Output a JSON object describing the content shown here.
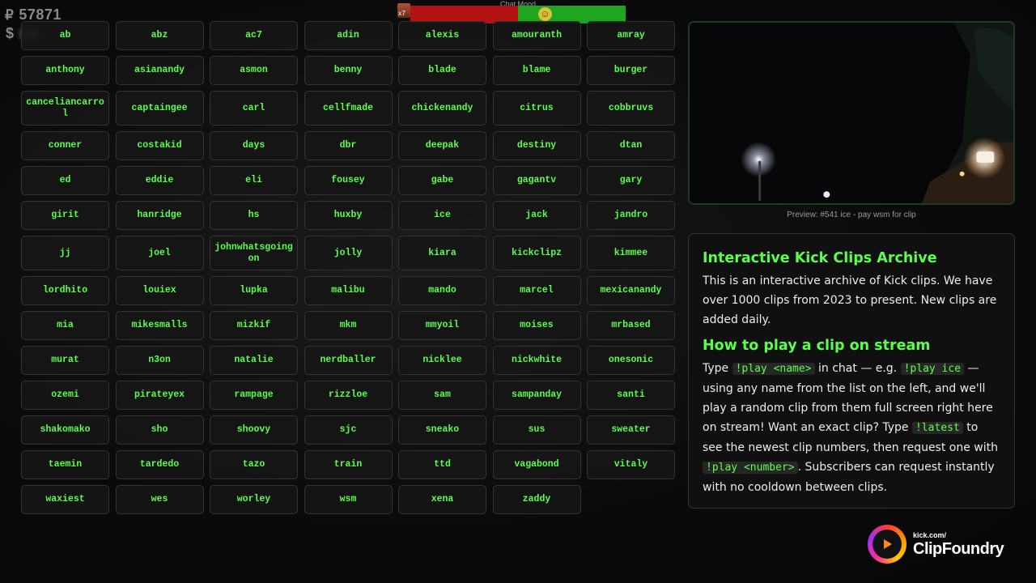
{
  "overlay": {
    "points_symbol": "₽",
    "points_value": "57871",
    "money_symbol": "$"
  },
  "chat_mood": {
    "title": "Chat Mood",
    "multiplier": "x7",
    "face": "☺",
    "neg_color": "#b31212",
    "pos_color": "#1fa51f"
  },
  "names": [
    "ab",
    "abz",
    "ac7",
    "adin",
    "alexis",
    "amouranth",
    "amray",
    "anthony",
    "asianandy",
    "asmon",
    "benny",
    "blade",
    "blame",
    "burger",
    "canceliancarrol",
    "captaingee",
    "carl",
    "cellfmade",
    "chickenandy",
    "citrus",
    "cobbruvs",
    "conner",
    "costakid",
    "days",
    "dbr",
    "deepak",
    "destiny",
    "dtan",
    "ed",
    "eddie",
    "eli",
    "fousey",
    "gabe",
    "gagantv",
    "gary",
    "girit",
    "hanridge",
    "hs",
    "huxby",
    "ice",
    "jack",
    "jandro",
    "jj",
    "joel",
    "johnwhatsgoingon",
    "jolly",
    "kiara",
    "kickclipz",
    "kimmee",
    "lordhito",
    "louiex",
    "lupka",
    "malibu",
    "mando",
    "marcel",
    "mexicanandy",
    "mia",
    "mikesmalls",
    "mizkif",
    "mkm",
    "mmyoil",
    "moises",
    "mrbased",
    "murat",
    "n3on",
    "natalie",
    "nerdballer",
    "nicklee",
    "nickwhite",
    "onesonic",
    "ozemi",
    "pirateyex",
    "rampage",
    "rizzloe",
    "sam",
    "sampanday",
    "santi",
    "shakomako",
    "sho",
    "shoovy",
    "sjc",
    "sneako",
    "sus",
    "sweater",
    "taemin",
    "tardedo",
    "tazo",
    "train",
    "ttd",
    "vagabond",
    "vitaly",
    "waxiest",
    "wes",
    "worley",
    "wsm",
    "xena",
    "zaddy"
  ],
  "preview": {
    "caption": "Preview: #541 ice - pay wsm for clip"
  },
  "info": {
    "heading1": "Interactive Kick Clips Archive",
    "para1": "This is an interactive archive of Kick clips. We have over 1000 clips from 2023 to present. New clips are added daily.",
    "heading2": "How to play a clip on stream",
    "p2_a": "Type ",
    "p2_code1": "!play <name>",
    "p2_b": " in chat — e.g. ",
    "p2_code2": "!play ice",
    "p2_c": " — using any name from the list on the left, and we'll play a random clip from them full screen right here on stream! Want an exact clip? Type ",
    "p2_code3": "!latest",
    "p2_d": " to see the newest clip numbers, then request one with ",
    "p2_code4": "!play <number>",
    "p2_e": ". Subscribers can request instantly with no cooldown between clips."
  },
  "logo": {
    "small": "kick.com/",
    "clip": "Clip",
    "foundry": "Foundry"
  },
  "colors": {
    "accent": "#5aff4a",
    "button_bg": "#161616"
  }
}
